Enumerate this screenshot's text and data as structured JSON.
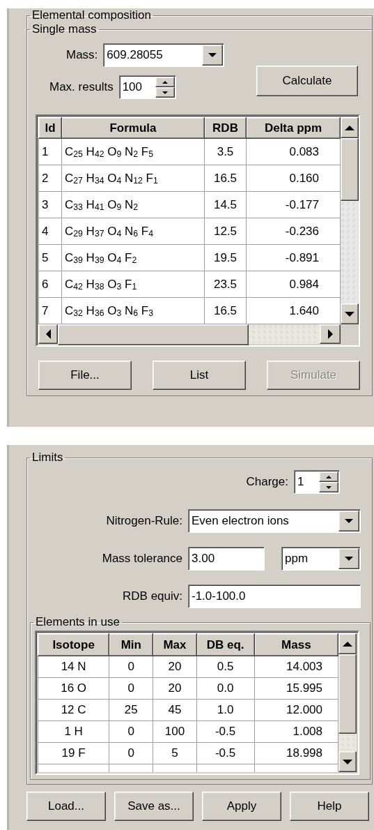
{
  "elemental_composition": {
    "title": "Elemental composition",
    "single_mass": {
      "title": "Single mass",
      "mass": {
        "label": "Mass:",
        "value": "609.28055"
      },
      "max_results": {
        "label": "Max. results",
        "value": "100"
      },
      "calculate_button": {
        "label": "Calculate"
      },
      "results_table": {
        "columns": [
          "Id",
          "Formula",
          "RDB",
          "Delta  ppm"
        ],
        "rows": [
          [
            "1",
            "C$_{25}$ H$_{42}$ O$_{9}$ N$_{2}$ F$_{5}$",
            "3.5",
            "0.083"
          ],
          [
            "2",
            "C$_{27}$ H$_{34}$ O$_{4}$ N$_{12}$ F$_{1}$",
            "16.5",
            "0.160"
          ],
          [
            "3",
            "C$_{33}$ H$_{41}$ O$_{9}$ N$_{2}$",
            "14.5",
            "-0.177"
          ],
          [
            "4",
            "C$_{29}$ H$_{37}$ O$_{4}$ N$_{6}$ F$_{4}$",
            "12.5",
            "-0.236"
          ],
          [
            "5",
            "C$_{39}$ H$_{39}$ O$_{4}$ F$_{2}$",
            "19.5",
            "-0.891"
          ],
          [
            "6",
            "C$_{42}$ H$_{38}$ O$_{3}$ F$_{1}$",
            "23.5",
            "0.984"
          ],
          [
            "7",
            "C$_{32}$ H$_{36}$ O$_{3}$ N$_{6}$ F$_{3}$",
            "16.5",
            "1.640"
          ]
        ]
      },
      "buttons": [
        {
          "label": "File...",
          "disabled": false
        },
        {
          "label": "List",
          "disabled": false
        },
        {
          "label": "Simulate",
          "disabled": true
        }
      ]
    }
  },
  "limits": {
    "title": "Limits",
    "charge": {
      "label": "Charge:",
      "value": "1"
    },
    "nitrogen_rule": {
      "label": "Nitrogen-Rule:",
      "value": "Even electron ions"
    },
    "mass_tolerance": {
      "label": "Mass tolerance",
      "value": "3.00",
      "unit": "ppm"
    },
    "rdb_equiv": {
      "label": "RDB equiv:",
      "value": "-1.0-100.0"
    },
    "elements_in_use": {
      "title": "Elements in use",
      "columns": [
        "Isotope",
        "Min",
        "Max",
        "DB eq.",
        "Mass"
      ],
      "rows": [
        [
          "14 N",
          "0",
          "20",
          "0.5",
          "14.003"
        ],
        [
          "16 O",
          "0",
          "20",
          "0.0",
          "15.995"
        ],
        [
          "12 C",
          "25",
          "45",
          "1.0",
          "12.000"
        ],
        [
          "1 H",
          "0",
          "100",
          "-0.5",
          "1.008"
        ],
        [
          "19 F",
          "0",
          "5",
          "-0.5",
          "18.998"
        ]
      ]
    }
  },
  "buttons": [
    {
      "label": "Load..."
    },
    {
      "label": "Save as..."
    },
    {
      "label": "Apply"
    },
    {
      "label": "Help"
    }
  ]
}
